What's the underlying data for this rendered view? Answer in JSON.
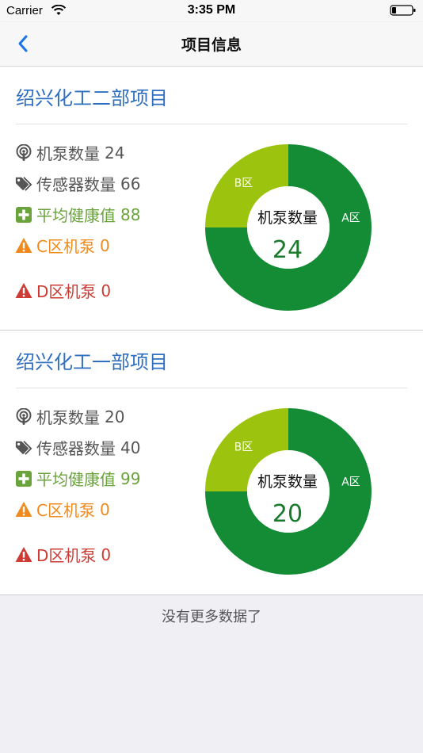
{
  "status_bar": {
    "carrier": "Carrier",
    "time": "3:35 PM"
  },
  "nav": {
    "title": "项目信息"
  },
  "colors": {
    "section_a": "#148c35",
    "section_b": "#9cc40e",
    "title_blue": "#2f6fc0",
    "health_green": "#6aa23c",
    "warning_orange": "#f08a1c",
    "danger_red": "#cd3b33"
  },
  "projects": [
    {
      "name": "绍兴化工二部项目",
      "stats": {
        "pump_label": "机泵数量",
        "pump_value": "24",
        "sensor_label": "传感器数量",
        "sensor_value": "66",
        "health_label": "平均健康值",
        "health_value": "88",
        "c_label": "C区机泵",
        "c_value": "0",
        "d_label": "D区机泵",
        "d_value": "0"
      },
      "chart_data": {
        "type": "pie",
        "center_label": "机泵数量",
        "center_value": "24",
        "categories": [
          "A区",
          "B区"
        ],
        "values": [
          18,
          6
        ],
        "colors": [
          "#148c35",
          "#9cc40e"
        ]
      }
    },
    {
      "name": "绍兴化工一部项目",
      "stats": {
        "pump_label": "机泵数量",
        "pump_value": "20",
        "sensor_label": "传感器数量",
        "sensor_value": "40",
        "health_label": "平均健康值",
        "health_value": "99",
        "c_label": "C区机泵",
        "c_value": "0",
        "d_label": "D区机泵",
        "d_value": "0"
      },
      "chart_data": {
        "type": "pie",
        "center_label": "机泵数量",
        "center_value": "20",
        "categories": [
          "A区",
          "B区"
        ],
        "values": [
          15,
          5
        ],
        "colors": [
          "#148c35",
          "#9cc40e"
        ]
      }
    }
  ],
  "footer": {
    "no_more": "没有更多数据了"
  }
}
